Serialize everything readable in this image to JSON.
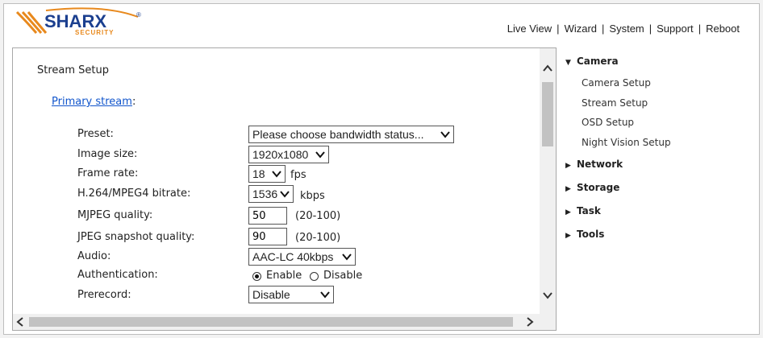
{
  "header": {
    "logo": {
      "brand": "SHARX",
      "sub": "SECURITY",
      "reg": "®"
    },
    "nav": [
      "Live View",
      "Wizard",
      "System",
      "Support",
      "Reboot"
    ]
  },
  "stream": {
    "title": "Stream Setup",
    "primary_link": "Primary stream",
    "primary_suffix": ":",
    "preset": {
      "label": "Preset:",
      "value": "Please choose bandwidth status..."
    },
    "image_size": {
      "label": "Image size:",
      "value": "1920x1080"
    },
    "frame_rate": {
      "label": "Frame rate:",
      "value": "18",
      "unit": "fps"
    },
    "bitrate": {
      "label": "H.264/MPEG4 bitrate:",
      "value": "1536",
      "unit": "kbps"
    },
    "mjpeg": {
      "label": "MJPEG quality:",
      "value": "50",
      "range": "(20-100)"
    },
    "jpeg": {
      "label": "JPEG snapshot quality:",
      "value": "90",
      "range": "(20-100)"
    },
    "audio": {
      "label": "Audio:",
      "value": "AAC-LC 40kbps"
    },
    "auth": {
      "label": "Authentication:",
      "enable": "Enable",
      "disable": "Disable",
      "selected": "Enable"
    },
    "prerecord": {
      "label": "Prerecord:",
      "value": "Disable"
    }
  },
  "sidebar": {
    "camera": {
      "label": "Camera",
      "expanded": true,
      "items": [
        "Camera Setup",
        "Stream Setup",
        "OSD Setup",
        "Night Vision Setup"
      ]
    },
    "network": "Network",
    "storage": "Storage",
    "task": "Task",
    "tools": "Tools"
  },
  "colors": {
    "link": "#1155cc",
    "logo_blue": "#1b3f8f",
    "logo_orange": "#e8891d"
  },
  "icons": [
    "chevron-down-icon",
    "triangle-down-icon",
    "triangle-right-icon",
    "scroll-up-icon",
    "scroll-down-icon",
    "scroll-left-icon",
    "scroll-right-icon"
  ]
}
